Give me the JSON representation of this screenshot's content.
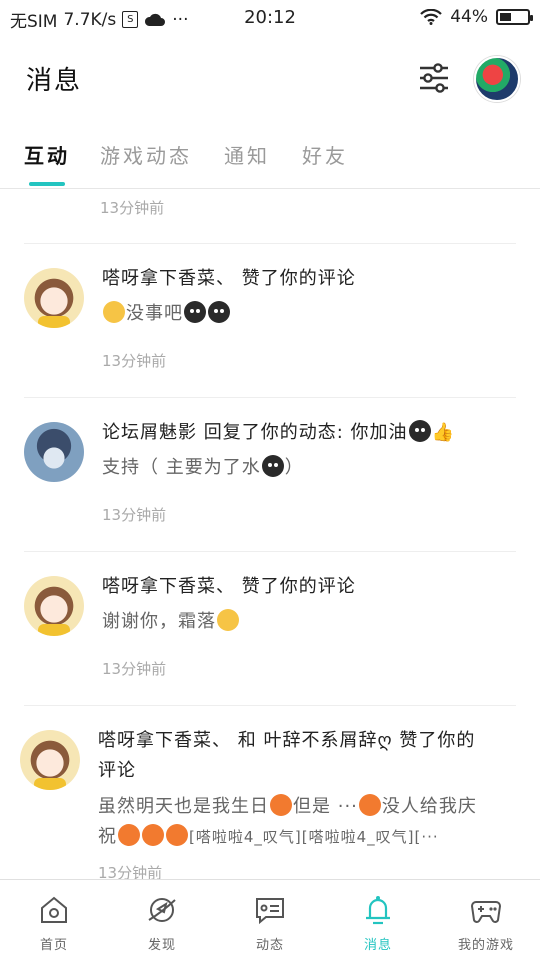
{
  "status_bar": {
    "carrier": "无SIM",
    "speed": "7.7K/s",
    "box_char": "S",
    "more": "···",
    "time": "20:12",
    "battery": "44%",
    "battery_level": 0.44
  },
  "header": {
    "title": "消息"
  },
  "tabs": [
    {
      "label": "互动",
      "active": true
    },
    {
      "label": "游戏动态",
      "active": false
    },
    {
      "label": "通知",
      "active": false
    },
    {
      "label": "好友",
      "active": false
    }
  ],
  "feed": {
    "top_time": "13分钟前",
    "items": [
      {
        "user": "嗒呀拿下香菜、",
        "action": " 赞了你的评论",
        "content": "没事吧",
        "time": "13分钟前"
      },
      {
        "user": "论坛屑魅影",
        "action": " 回复了你的动态: 你加油",
        "content_pre": "支持（ 主要为了水",
        "content_post": "）",
        "time": "13分钟前"
      },
      {
        "user": "嗒呀拿下香菜、",
        "action": " 赞了你的评论",
        "content": "谢谢你，霜落",
        "time": "13分钟前"
      },
      {
        "user": "嗒呀拿下香菜、",
        "action": " 和 叶辞不系屑辞ღ 赞了你的",
        "action_line2": "评论",
        "content_a": "虽然明天也是我生日",
        "content_b": "但是 ···",
        "content_c": "没人给我庆",
        "content_d": "祝",
        "content_e": "[嗒啦啦4_叹气][嗒啦啦4_叹气][···",
        "time": "13分钟前"
      }
    ]
  },
  "bottom_nav": [
    {
      "label": "首页",
      "icon": "home-icon",
      "active": false
    },
    {
      "label": "发现",
      "icon": "discover-icon",
      "active": false
    },
    {
      "label": "动态",
      "icon": "feed-icon",
      "active": false
    },
    {
      "label": "消息",
      "icon": "bell-icon",
      "active": true
    },
    {
      "label": "我的游戏",
      "icon": "gamepad-icon",
      "active": false
    }
  ],
  "colors": {
    "accent": "#23c4c0",
    "text": "#222222",
    "muted": "#aaaaaa"
  }
}
